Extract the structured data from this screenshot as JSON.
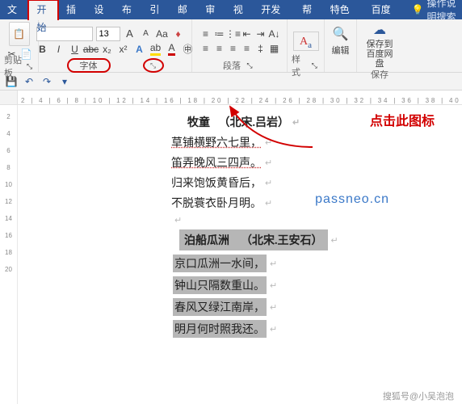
{
  "menubar": {
    "tabs": [
      "文件",
      "开始",
      "插入",
      "设计",
      "布局",
      "引用",
      "邮件",
      "审阅",
      "视图",
      "开发工具",
      "帮助",
      "特色功能",
      "百度网盘"
    ],
    "active_index": 1,
    "hint": "操作说明搜索"
  },
  "ribbon": {
    "clipboard": {
      "label": "剪贴板"
    },
    "font": {
      "name_value": "",
      "size_value": "13",
      "buttons_row2": [
        "B",
        "I",
        "U",
        "abc",
        "x₂",
        "x²",
        "A"
      ],
      "label": "字体",
      "grow": "A",
      "shrink": "A",
      "aa": "Aa",
      "clear": "A"
    },
    "paragraph": {
      "label": "段落"
    },
    "styles": {
      "label": "样式"
    },
    "editing": {
      "label": "编辑"
    },
    "save": {
      "label": "保存到百度网盘",
      "group_label": "保存"
    }
  },
  "callout": "点击此图标",
  "watermark": "passneo.cn",
  "doc": {
    "poem1": {
      "title_a": "牧童",
      "title_b": "（北宋.吕岩）",
      "lines": [
        "草铺横野六七里，",
        "笛弄晚风三四声。",
        "归来饱饭黄昏后，",
        "不脱蓑衣卧月明。"
      ]
    },
    "poem2": {
      "title_a": "泊船瓜洲",
      "title_b": "（北宋.王安石）",
      "lines": [
        "京口瓜洲一水间，",
        "钟山只隔数重山。",
        "春风又绿江南岸，",
        "明月何时照我还。"
      ]
    }
  },
  "credit": "搜狐号@小吴泡泡",
  "h_ruler_marks": "2 | 4 | 6 | 8 | 10 | 12 | 14 | 16 | 18 | 20 | 22 | 24 | 26 | 28 | 30 | 32 | 34 | 36 | 38 | 40",
  "v_ruler_marks": [
    "2",
    "4",
    "6",
    "8",
    "10",
    "12",
    "14",
    "16",
    "18",
    "20"
  ]
}
